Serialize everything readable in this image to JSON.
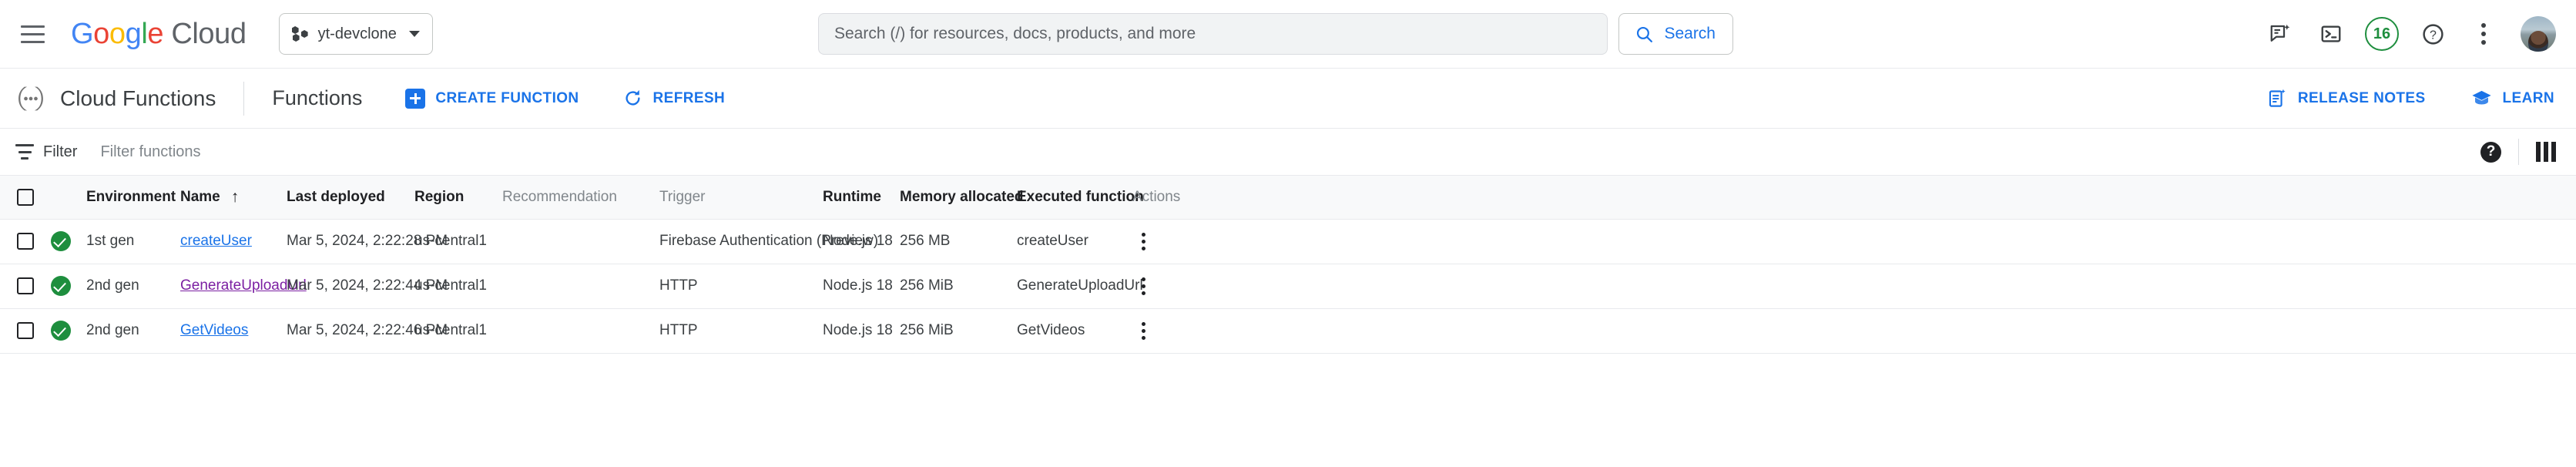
{
  "topbar": {
    "menu_icon": "hamburger-menu-icon",
    "brand": {
      "google": "Google",
      "cloud": "Cloud"
    },
    "project": {
      "name": "yt-devclone",
      "icon": "project-dots-icon",
      "caret": "chevron-down-icon"
    },
    "search": {
      "placeholder": "Search (/) for resources, docs, products, and more",
      "value": "",
      "button_label": "Search",
      "button_icon": "search-icon"
    },
    "actions": [
      {
        "name": "gemini-chat-icon",
        "label": ""
      },
      {
        "name": "cloud-shell-icon",
        "label": ""
      },
      {
        "name": "notifications-badge",
        "label": "16"
      },
      {
        "name": "help-icon",
        "label": "?"
      },
      {
        "name": "more-options-icon",
        "label": ""
      },
      {
        "name": "account-avatar",
        "label": ""
      }
    ]
  },
  "pagehead": {
    "product_icon": "cloud-functions-icon",
    "product_title": "Cloud Functions",
    "section_title": "Functions",
    "create_button": {
      "label": "CREATE FUNCTION",
      "icon": "plus-icon"
    },
    "refresh_button": {
      "label": "REFRESH",
      "icon": "refresh-icon"
    },
    "release_notes_button": {
      "label": "RELEASE NOTES",
      "icon": "release-notes-icon"
    },
    "learn_button": {
      "label": "LEARN",
      "icon": "graduation-cap-icon"
    }
  },
  "filterbar": {
    "filter_label": "Filter",
    "filter_icon": "filter-icon",
    "filter_placeholder": "Filter functions",
    "filter_value": "",
    "help_icon": "help-filled-icon",
    "columns_icon": "column-display-icon"
  },
  "table": {
    "select_all_checkbox": "select-all-checkbox",
    "columns": [
      {
        "key": "checkbox",
        "label": "",
        "muted": false
      },
      {
        "key": "status",
        "label": "",
        "muted": false
      },
      {
        "key": "environment",
        "label": "Environment",
        "muted": false
      },
      {
        "key": "name",
        "label": "Name",
        "muted": false,
        "sort": "asc"
      },
      {
        "key": "deployed",
        "label": "Last deployed",
        "muted": false
      },
      {
        "key": "region",
        "label": "Region",
        "muted": false
      },
      {
        "key": "recommend",
        "label": "Recommendation",
        "muted": true
      },
      {
        "key": "trigger",
        "label": "Trigger",
        "muted": true
      },
      {
        "key": "runtime",
        "label": "Runtime",
        "muted": false
      },
      {
        "key": "memory",
        "label": "Memory allocated",
        "muted": false
      },
      {
        "key": "executed",
        "label": "Executed function",
        "muted": false
      },
      {
        "key": "actions",
        "label": "Actions",
        "muted": true
      }
    ],
    "sort_arrow": "↑",
    "rows": [
      {
        "status": "ok",
        "environment": "1st gen",
        "name": "createUser",
        "name_visited": false,
        "deployed": "Mar 5, 2024, 2:22:28 PM",
        "region": "us-central1",
        "recommendation": "",
        "trigger": "Firebase Authentication (Preview)",
        "runtime": "Node.js 18",
        "memory": "256 MB",
        "executed": "createUser"
      },
      {
        "status": "ok",
        "environment": "2nd gen",
        "name": "GenerateUploadUrl",
        "name_visited": true,
        "deployed": "Mar 5, 2024, 2:22:44 PM",
        "region": "us-central1",
        "recommendation": "",
        "trigger": "HTTP",
        "runtime": "Node.js 18",
        "memory": "256 MiB",
        "executed": "GenerateUploadUrl"
      },
      {
        "status": "ok",
        "environment": "2nd gen",
        "name": "GetVideos",
        "name_visited": false,
        "deployed": "Mar 5, 2024, 2:22:46 PM",
        "region": "us-central1",
        "recommendation": "",
        "trigger": "HTTP",
        "runtime": "Node.js 18",
        "memory": "256 MiB",
        "executed": "GetVideos"
      }
    ]
  },
  "colors": {
    "accent_blue": "#1a73e8",
    "visited_purple": "#7b1fa2",
    "status_green": "#1e8e3e",
    "text_primary": "#3c4043",
    "text_muted": "#80868b",
    "header_bg": "#f8f9fa",
    "border": "#e8eaed"
  }
}
